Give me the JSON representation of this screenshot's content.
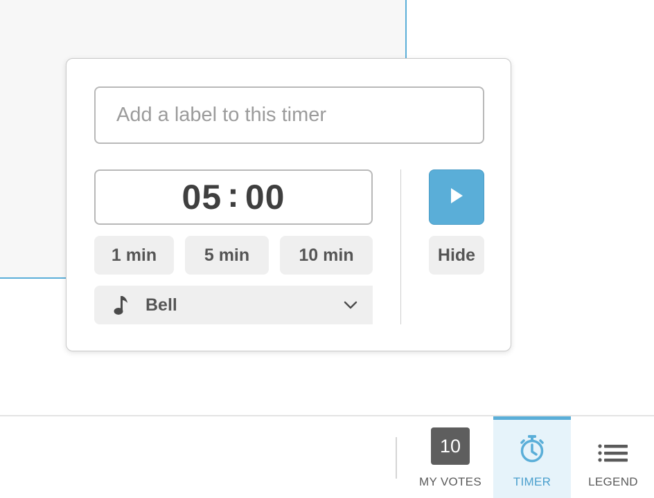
{
  "timer_popup": {
    "label_placeholder": "Add a label to this timer",
    "label_value": "",
    "time": {
      "minutes": "05",
      "separator": ":",
      "seconds": "00"
    },
    "presets": [
      "1 min",
      "5 min",
      "10 min"
    ],
    "sound": {
      "icon": "music-note-icon",
      "selected": "Bell"
    },
    "hide_label": "Hide",
    "play_icon": "play-icon"
  },
  "toolbar": {
    "my_votes": {
      "count": "10",
      "label": "MY VOTES"
    },
    "timer": {
      "label": "TIMER",
      "icon": "stopwatch-icon",
      "active": true
    },
    "legend": {
      "label": "LEGEND",
      "icon": "list-icon"
    }
  },
  "colors": {
    "accent": "#5aaed8",
    "active_tab_bg": "#e6f3fa",
    "button_bg": "#efefef",
    "badge_bg": "#5e5e5e"
  }
}
